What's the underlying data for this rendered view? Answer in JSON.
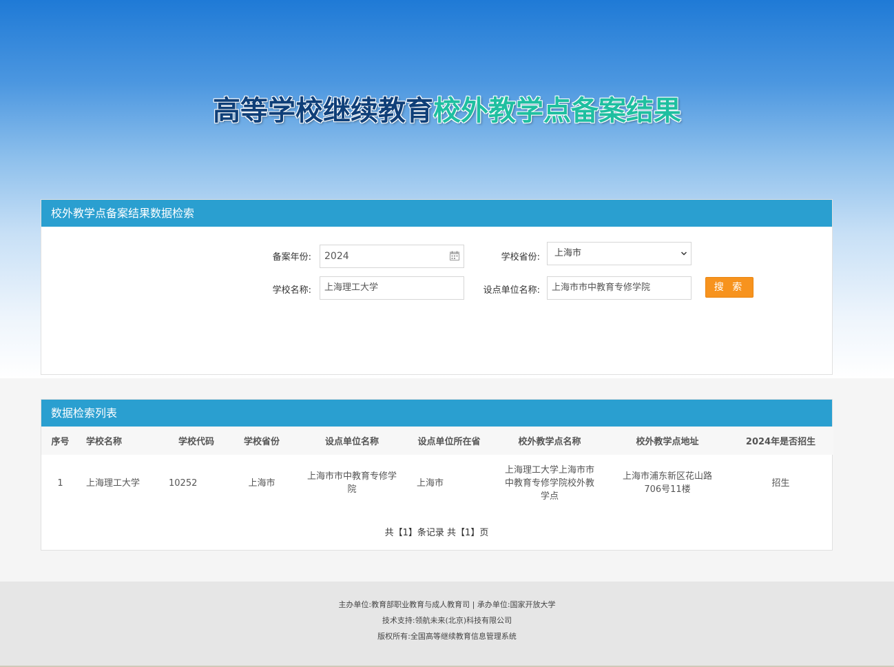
{
  "hero": {
    "title_part1": "高等学校继续教育",
    "title_part2": "校外教学点备案结果"
  },
  "search": {
    "header": "校外教学点备案结果数据检索",
    "year_label": "备案年份:",
    "year_value": "2024",
    "province_label": "学校省份:",
    "province_value": "上海市",
    "school_label": "学校名称:",
    "school_value": "上海理工大学",
    "unit_label": "设点单位名称:",
    "unit_value": "上海市市中教育专修学院",
    "search_button": "搜 索"
  },
  "results": {
    "header": "数据检索列表",
    "columns": [
      "序号",
      "学校名称",
      "学校代码",
      "学校省份",
      "设点单位名称",
      "设点单位所在省",
      "校外教学点名称",
      "校外教学点地址",
      "2024年是否招生"
    ],
    "rows": [
      [
        "1",
        "上海理工大学",
        "10252",
        "上海市",
        "上海市市中教育专修学院",
        "上海市",
        "上海理工大学上海市市中教育专修学院校外教学点",
        "上海市浦东新区花山路706号11楼",
        "招生"
      ]
    ],
    "pagination": "共【1】条记录 共【1】页"
  },
  "footer": {
    "line1": "主办单位:教育部职业教育与成人教育司 | 承办单位:国家开放大学",
    "line2": "技术支持:领航未来(北京)科技有限公司",
    "line3": "版权所有:全国高等继续教育信息管理系统"
  },
  "colors": {
    "header_bar": "#2a9fd0",
    "search_button": "#f7931e",
    "title_dark": "#0f3f78",
    "title_accent": "#1fbfa0"
  }
}
